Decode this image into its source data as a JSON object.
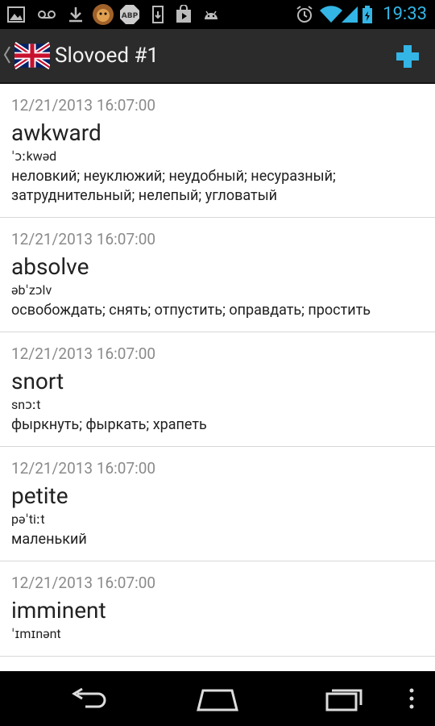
{
  "status_bar": {
    "time": "19:33",
    "icons_left": [
      "gallery-icon",
      "voicemail-icon",
      "download-icon",
      "lion-app-icon",
      "adblock-icon",
      "sd-card-icon",
      "play-store-icon",
      "android-icon"
    ],
    "icons_right": [
      "alarm-icon",
      "wifi-icon",
      "signal-icon",
      "battery-icon"
    ]
  },
  "action_bar": {
    "title": "Slovoed #1",
    "flag": "uk-flag-icon",
    "add_icon": "add-icon",
    "accent": "#33b5e5"
  },
  "entries": [
    {
      "date": "12/21/2013 16:07:00",
      "word": "awkward",
      "pron": "ˈɔːkwəd",
      "trans": "неловкий; неуклюжий; неудобный; несуразный; затруднительный; нелепый; угловатый"
    },
    {
      "date": "12/21/2013 16:07:00",
      "word": "absolve",
      "pron": "əbˈzɔlv",
      "trans": "освобождать; снять; отпустить; оправдать; простить"
    },
    {
      "date": "12/21/2013 16:07:00",
      "word": "snort",
      "pron": "snɔːt",
      "trans": "фыркнуть; фыркать; храпеть"
    },
    {
      "date": "12/21/2013 16:07:00",
      "word": "petite",
      "pron": "pəˈtiːt",
      "trans": "маленький"
    },
    {
      "date": "12/21/2013 16:07:00",
      "word": "imminent",
      "pron": "ˈɪmɪnənt",
      "trans": ""
    }
  ],
  "nav_bar": {
    "icons": [
      "back-icon",
      "home-icon",
      "recents-icon",
      "menu-icon"
    ]
  }
}
